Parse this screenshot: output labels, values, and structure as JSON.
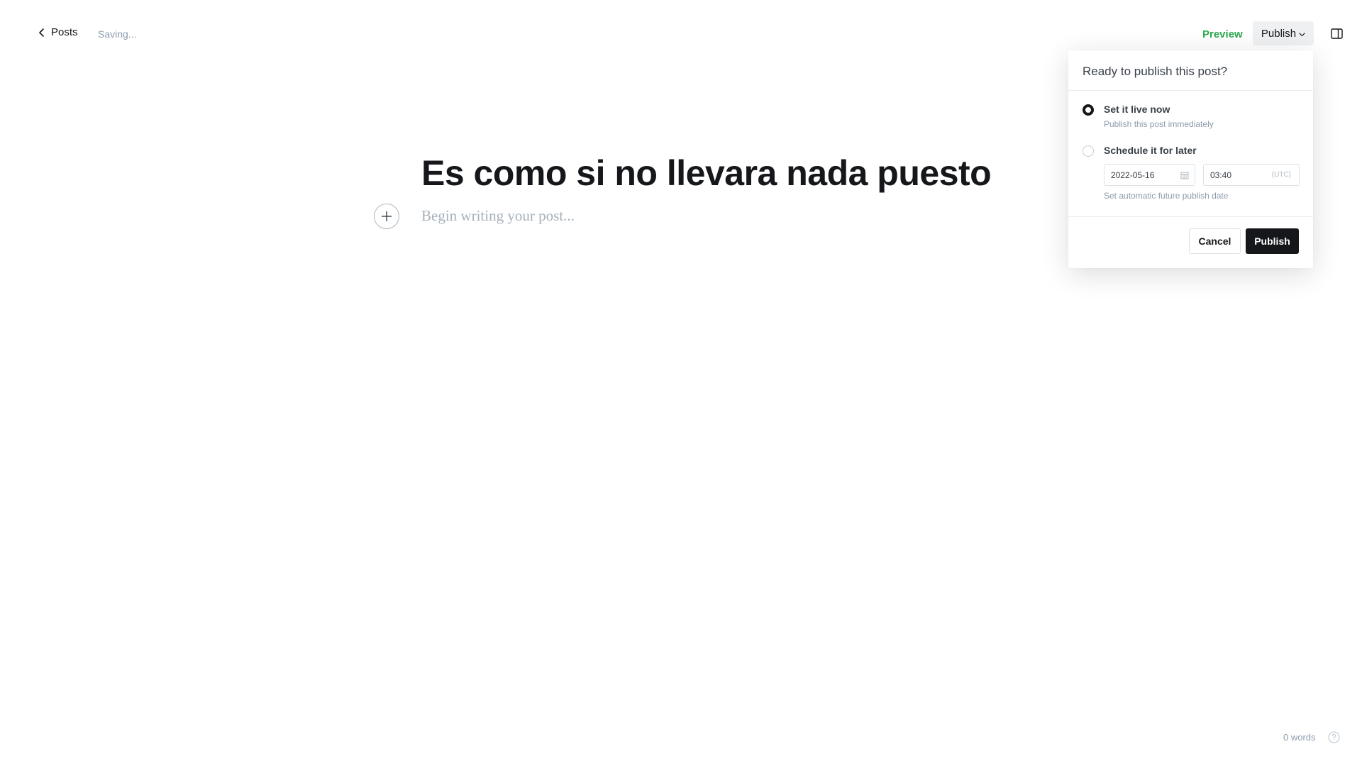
{
  "topbar": {
    "back_label": "Posts",
    "status": "Saving...",
    "preview_label": "Preview",
    "publish_label": "Publish"
  },
  "editor": {
    "title": "Es como si no llevara nada puesto",
    "body_placeholder": "Begin writing your post..."
  },
  "publish_menu": {
    "heading": "Ready to publish this post?",
    "options": [
      {
        "label": "Set it live now",
        "description": "Publish this post immediately",
        "selected": true
      },
      {
        "label": "Schedule it for later",
        "selected": false
      }
    ],
    "schedule_date": "2022-05-16",
    "schedule_time": "03:40",
    "timezone": "(UTC)",
    "schedule_hint": "Set automatic future publish date",
    "cancel_label": "Cancel",
    "confirm_label": "Publish"
  },
  "footer": {
    "word_count": "0 words"
  },
  "colors": {
    "preview_green": "#2fa84f",
    "dark": "#15171a",
    "muted": "#8e9cac"
  },
  "icons": {
    "back": "chevron-left-icon",
    "dropdown": "chevron-down-icon",
    "sidebar": "sidebar-toggle-icon",
    "add": "plus-icon",
    "calendar": "calendar-icon",
    "help": "question-circle-icon"
  }
}
